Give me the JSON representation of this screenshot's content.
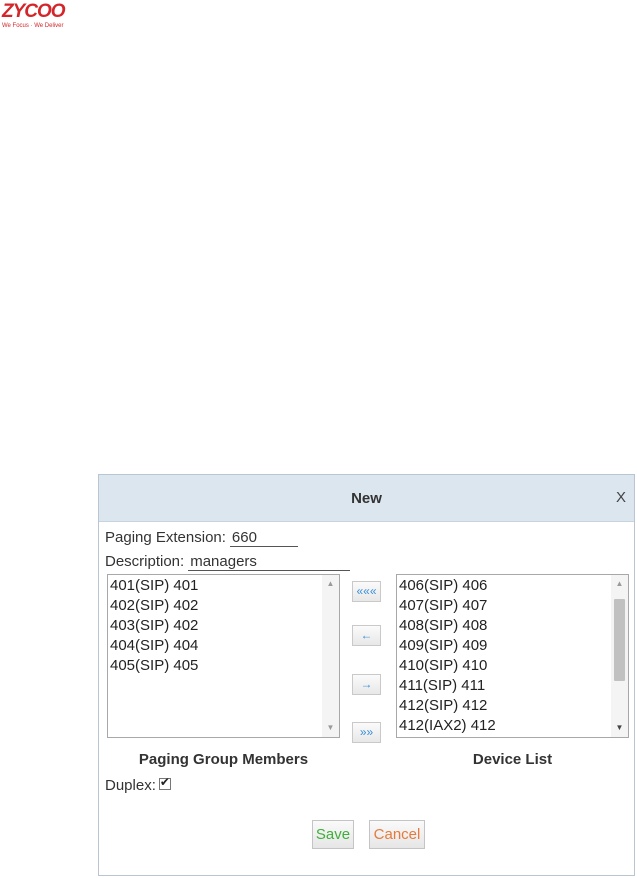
{
  "logo": {
    "brand": "ZYCOO",
    "tagline": "We Focus · We Deliver"
  },
  "dialog": {
    "title": "New",
    "close_label": "X",
    "paging_extension": {
      "label": "Paging Extension:",
      "value": "660"
    },
    "description": {
      "label": "Description:",
      "value": "managers"
    },
    "members": {
      "caption": "Paging Group Members",
      "items": [
        "401(SIP) 401",
        "402(SIP) 402",
        "403(SIP) 402",
        "404(SIP) 404",
        "405(SIP) 405"
      ]
    },
    "devices": {
      "caption": "Device List",
      "items": [
        "406(SIP) 406",
        "407(SIP) 407",
        "408(SIP) 408",
        "409(SIP) 409",
        "410(SIP) 410",
        "411(SIP) 411",
        "412(SIP) 412",
        "412(IAX2) 412"
      ]
    },
    "transfer_buttons": {
      "add_all": "«««",
      "add_one": "←",
      "remove_one": "→",
      "remove_all": "»»"
    },
    "duplex": {
      "label": "Duplex:",
      "checked": true
    },
    "save_label": "Save",
    "cancel_label": "Cancel"
  },
  "colors": {
    "header_bg": "#dbe6ef",
    "save_text": "#3fae3b",
    "cancel_text": "#e57b3b",
    "arrow_text": "#3a8fd9",
    "logo_red": "#d4262a"
  }
}
